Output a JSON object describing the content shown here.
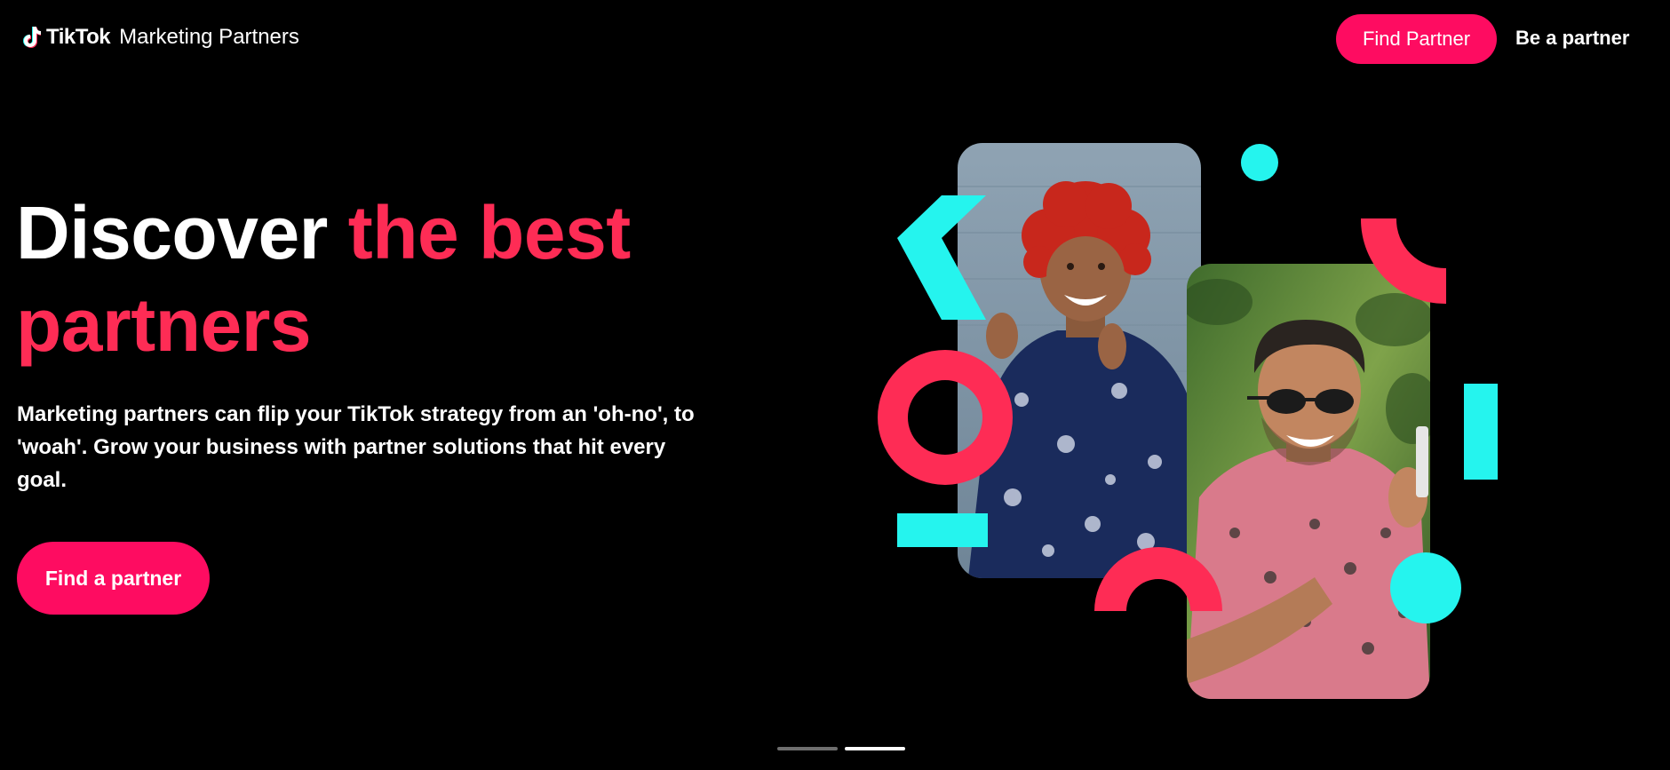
{
  "header": {
    "logo_brand": "TikTok",
    "logo_sub": "Marketing Partners",
    "nav_find_label": "Find Partner",
    "nav_be_label": "Be a partner"
  },
  "hero": {
    "title_white": "Discover ",
    "title_pink": "the best partners",
    "description": "Marketing partners can flip your TikTok strategy from an 'oh-no', to 'woah'. Grow your business with partner solutions that hit every goal.",
    "cta_label": "Find a partner"
  },
  "carousel": {
    "slide_count": 2,
    "active_index": 1
  },
  "colors": {
    "background": "#000000",
    "accent_pink": "#fe2c55",
    "button_pink": "#fe0c61",
    "accent_cyan": "#25f4ee",
    "text": "#ffffff"
  },
  "icons": {
    "logo": "tiktok-note-icon"
  }
}
